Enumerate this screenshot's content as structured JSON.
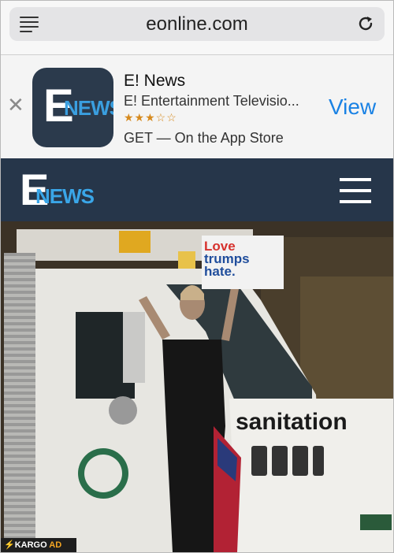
{
  "browser": {
    "url": "eonline.com"
  },
  "app_banner": {
    "close_label": "✕",
    "app_name": "E! News",
    "publisher": "E! Entertainment Televisio...",
    "rating_stars": "★★★☆☆",
    "get_text": "GET — On the App Store",
    "view_label": "View",
    "icon_letter": "E",
    "icon_word": "NEWS"
  },
  "site_header": {
    "logo_letter": "E",
    "logo_word": "NEWS"
  },
  "hero": {
    "sign_line1": "Love",
    "sign_line2": "trumps",
    "sign_line3": "hate.",
    "truck_text": "sanitation",
    "ad_badge_brand": "⚡KARGO",
    "ad_badge_label": "AD"
  },
  "colors": {
    "accent": "#1a82e4",
    "header_bg": "#26364a",
    "news_blue": "#3aa6e8"
  }
}
